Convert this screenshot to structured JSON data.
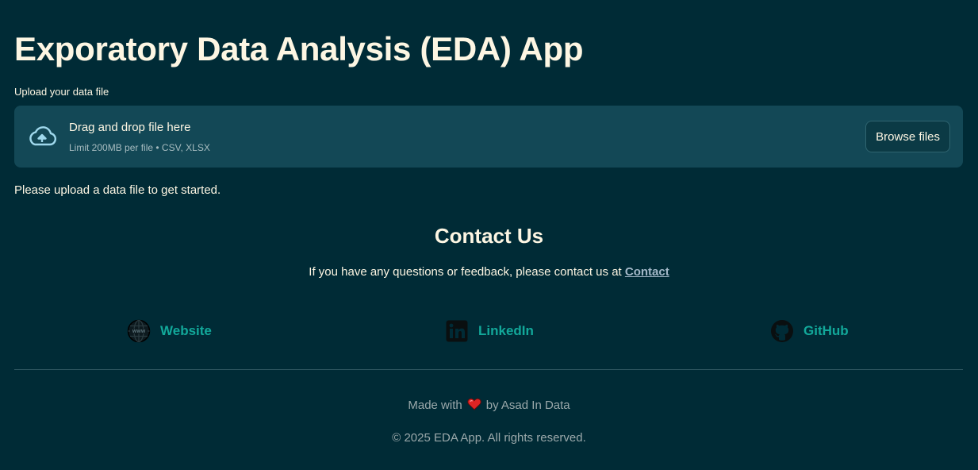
{
  "app": {
    "title": "Exporatory Data Analysis (EDA) App"
  },
  "uploader": {
    "label": "Upload your data file",
    "drop_text": "Drag and drop file here",
    "limit_text": "Limit 200MB per file • CSV, XLSX",
    "browse_label": "Browse files",
    "icon": "cloud-upload-icon"
  },
  "status": {
    "message": "Please upload a data file to get started."
  },
  "contact": {
    "title": "Contact Us",
    "text": "If you have any questions or feedback, please contact us at",
    "link_label": "Contact"
  },
  "social": [
    {
      "label": "Website",
      "icon": "globe-icon"
    },
    {
      "label": "LinkedIn",
      "icon": "linkedin-icon"
    },
    {
      "label": "GitHub",
      "icon": "github-icon"
    }
  ],
  "footer": {
    "made_with_prefix": "Made with",
    "made_with_suffix": "by Asad In Data",
    "copyright": "© 2025 EDA App. All rights reserved."
  },
  "colors": {
    "background": "#002b36",
    "dropzone": "#134856",
    "text": "#fdf6e3",
    "link_accent": "#12a89a",
    "heart": "#e02424"
  }
}
